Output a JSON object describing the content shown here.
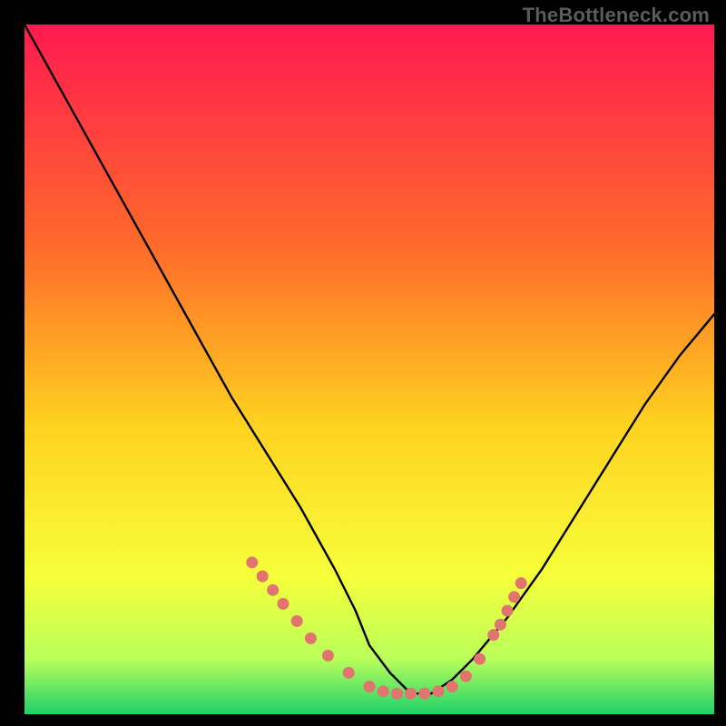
{
  "watermark": "TheBottleneck.com",
  "colors": {
    "background": "#000000",
    "curve": "#000000",
    "dots": "#e2746f",
    "gradient_top": "#ff1a4f",
    "gradient_mid1": "#ff6a2a",
    "gradient_mid2": "#ffd21f",
    "gradient_mid3": "#f6ff3a",
    "gradient_mid4": "#b9ff5a",
    "gradient_bottom": "#1fd06a"
  },
  "chart_data": {
    "type": "line",
    "title": "",
    "xlabel": "",
    "ylabel": "",
    "xlim": [
      0,
      100
    ],
    "ylim": [
      0,
      100
    ],
    "grid": false,
    "legend": false,
    "note": "V-shaped bottleneck curve on vertical red→green gradient background; minimum near x≈56. y is the curve height as percent of plot height (0 = bottom/green, 100 = top/red). Points are estimated from the image.",
    "series": [
      {
        "name": "curve",
        "x": [
          0,
          5,
          10,
          15,
          20,
          25,
          30,
          35,
          40,
          45,
          48,
          50,
          53,
          56,
          59,
          62,
          65,
          70,
          75,
          80,
          85,
          90,
          95,
          100
        ],
        "y": [
          100,
          91,
          82,
          73,
          64,
          55,
          46,
          38,
          30,
          21,
          15,
          10,
          6,
          3,
          3,
          5,
          8,
          14,
          21,
          29,
          37,
          45,
          52,
          58
        ]
      }
    ],
    "highlight_points": {
      "name": "salmon-dots",
      "x": [
        33.0,
        34.5,
        36.0,
        37.5,
        39.5,
        41.5,
        44.0,
        47.0,
        50.0,
        52.0,
        54.0,
        56.0,
        58.0,
        60.0,
        62.0,
        64.0,
        66.0,
        68.0,
        69.0,
        70.0,
        71.0,
        72.0
      ],
      "y": [
        22.0,
        20.0,
        18.0,
        16.0,
        13.5,
        11.0,
        8.5,
        6.0,
        4.0,
        3.3,
        3.0,
        3.0,
        3.0,
        3.3,
        4.0,
        5.5,
        8.0,
        11.5,
        13.0,
        15.0,
        17.0,
        19.0
      ]
    }
  }
}
